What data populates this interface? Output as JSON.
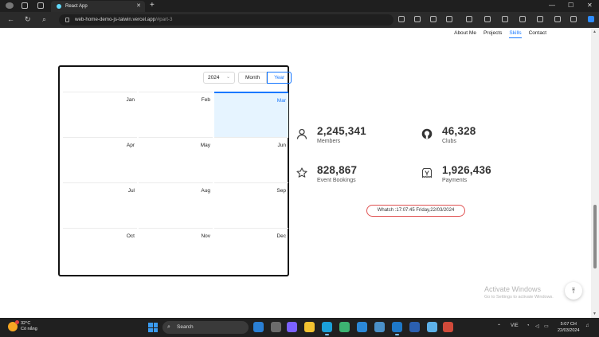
{
  "browser": {
    "tab_title": "React App",
    "tab_close": "✕",
    "new_tab": "+",
    "url_host": "web-home-demo-js-taiwin.vercel.app",
    "url_path": "/#part-3",
    "back": "←",
    "reload": "↻",
    "search": "⌕",
    "minimize": "—",
    "maximize": "☐",
    "close": "✕"
  },
  "nav": {
    "items": [
      "About Me",
      "Projects",
      "Skills",
      "Contact"
    ],
    "active": "Skills"
  },
  "calendar": {
    "year": "2024",
    "mode_month": "Month",
    "mode_year": "Year",
    "active_mode": "Year",
    "months": [
      "Jan",
      "Feb",
      "Mar",
      "Apr",
      "May",
      "Jun",
      "Jul",
      "Aug",
      "Sep",
      "Oct",
      "Nov",
      "Dec"
    ],
    "selected_month": "Mar"
  },
  "stats": [
    {
      "value": "2,245,341",
      "label": "Members",
      "icon": "user-icon"
    },
    {
      "value": "46,328",
      "label": "Clubs",
      "icon": "github-icon"
    },
    {
      "value": "828,867",
      "label": "Event Bookings",
      "icon": "star-icon"
    },
    {
      "value": "1,926,436",
      "label": "Payments",
      "icon": "payment-icon"
    }
  ],
  "clock_text": "Whatch :17:07:45 Friday,22/03/2024",
  "watermark": {
    "title": "Activate Windows",
    "subtitle": "Go to Settings to activate Windows."
  },
  "back_to_top": "⤒",
  "taskbar": {
    "weather_temp": "32°C",
    "weather_desc": "Có nắng",
    "search_label": "Search",
    "language": "VIE",
    "time": "5:07 CH",
    "date": "22/03/2024"
  },
  "colors": {
    "accent": "#1677ff",
    "selected_bg": "#e6f4ff",
    "clock_border": "#e05252"
  }
}
